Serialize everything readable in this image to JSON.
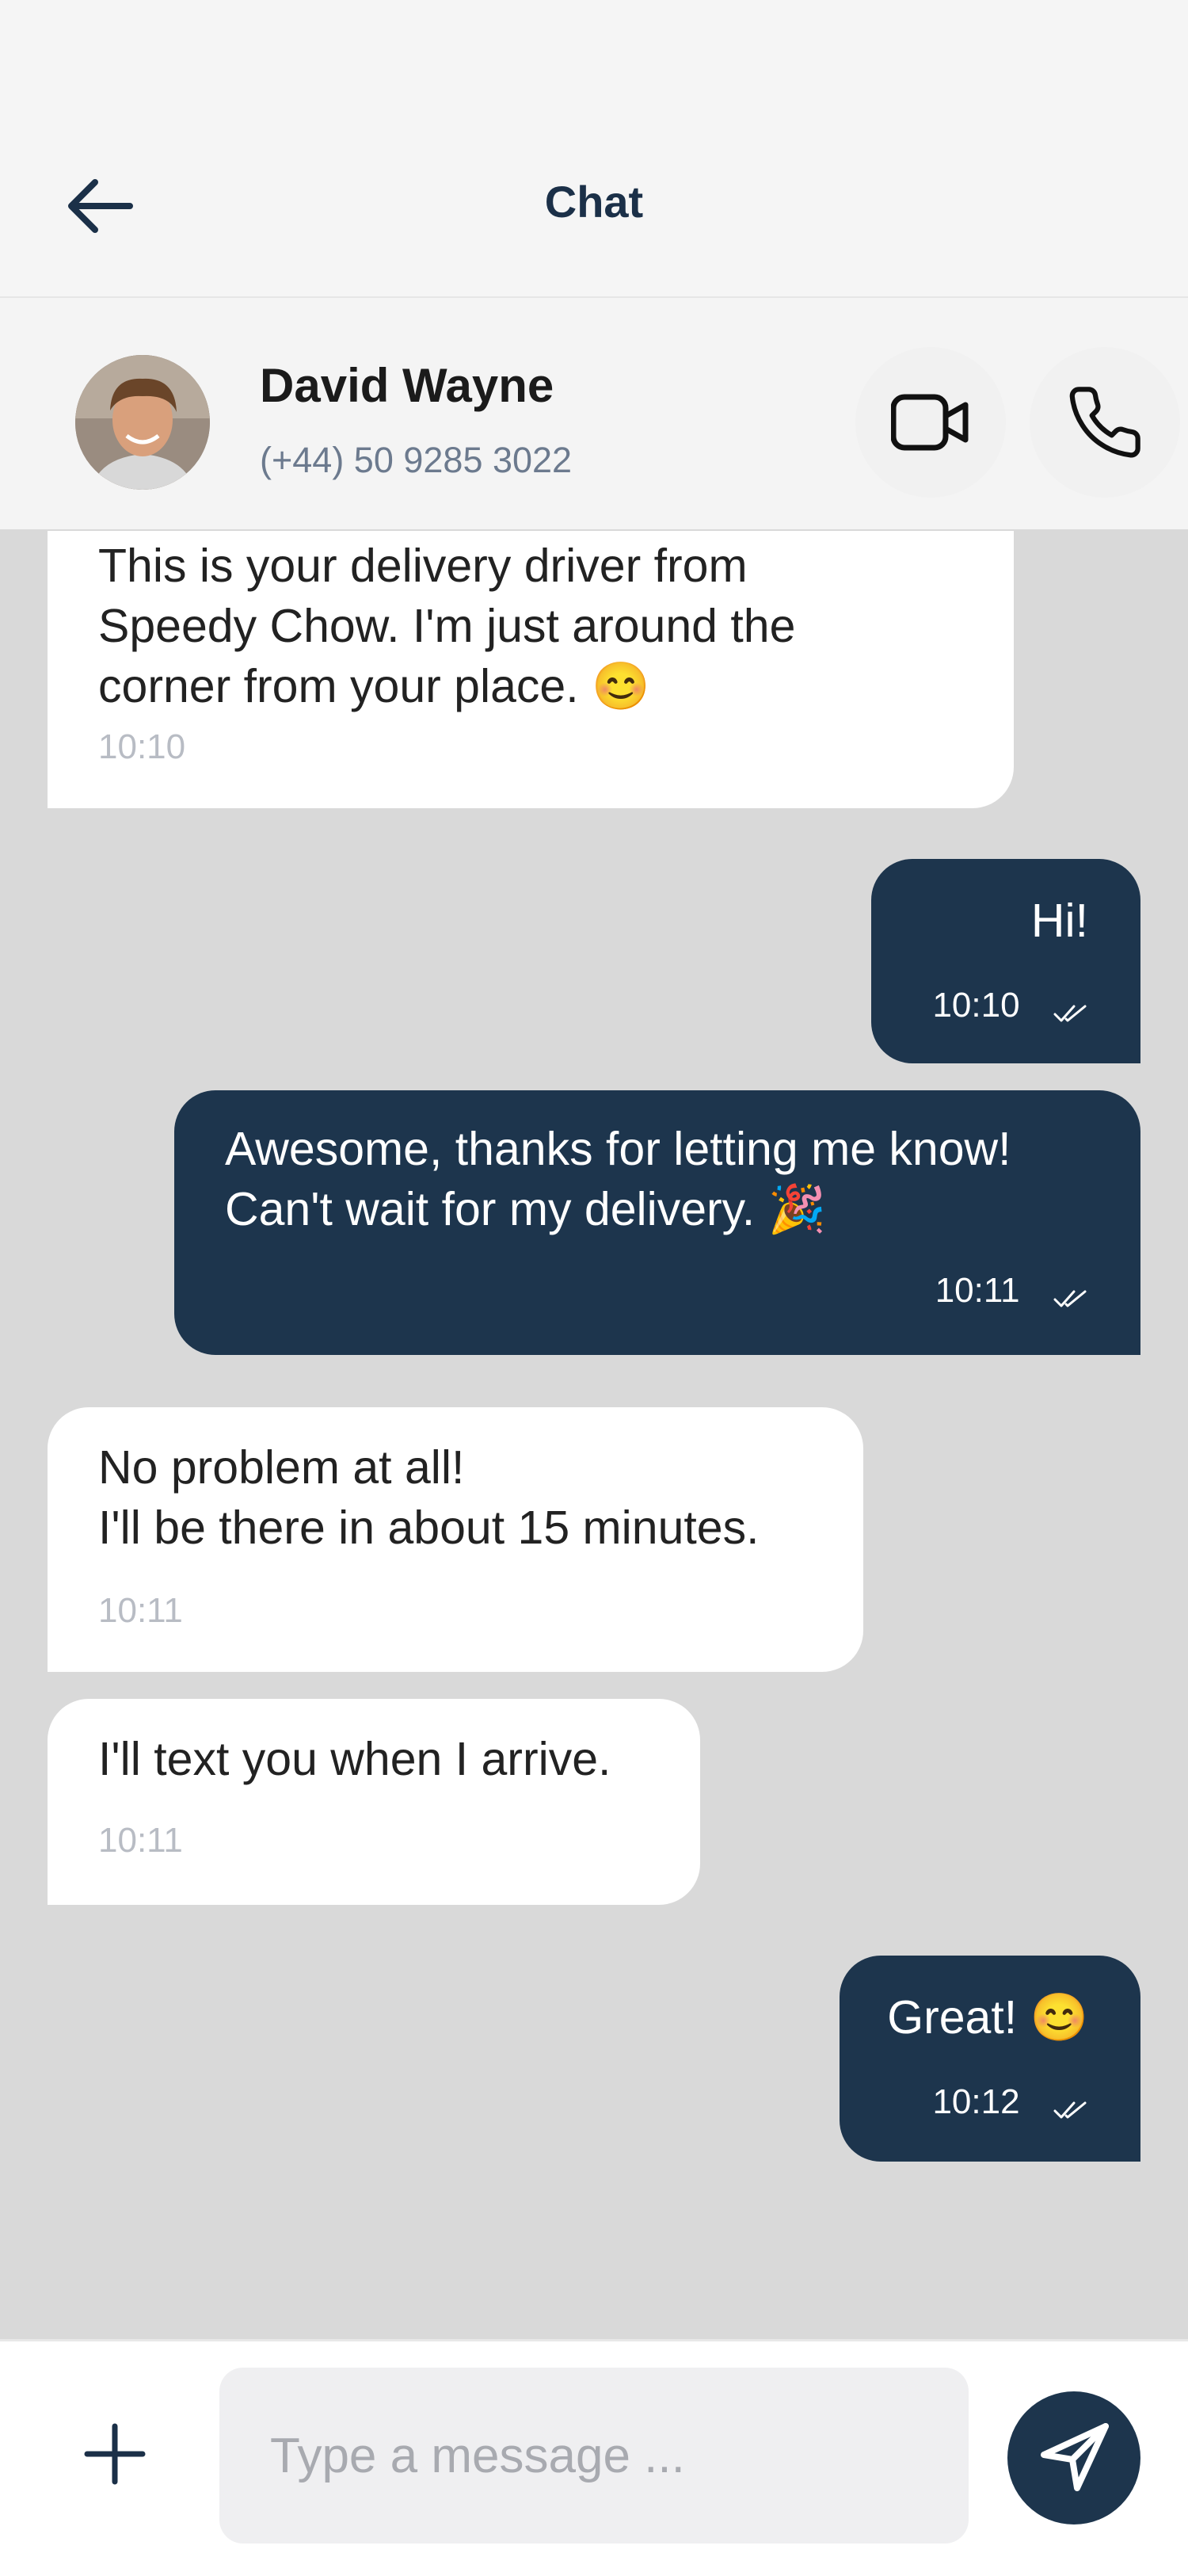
{
  "header": {
    "title": "Chat",
    "back_icon": "arrow-left-icon"
  },
  "contact": {
    "name": "David Wayne",
    "phone": "(+44) 50 9285 3022",
    "video_icon": "video-camera-icon",
    "call_icon": "phone-icon"
  },
  "messages": [
    {
      "direction": "incoming",
      "text": "This is your delivery driver from\nSpeedy Chow. I'm just around the\ncorner from your place. 😊",
      "time": "10:10"
    },
    {
      "direction": "outgoing",
      "text": "Hi!",
      "time": "10:10",
      "read": true
    },
    {
      "direction": "outgoing",
      "text": "Awesome, thanks for letting me know!\nCan't wait for my delivery. 🎉",
      "time": "10:11",
      "read": true
    },
    {
      "direction": "incoming",
      "text": "No problem at all!\nI'll be there in about 15 minutes.",
      "time": "10:11"
    },
    {
      "direction": "incoming",
      "text": "I'll text you when I arrive.",
      "time": "10:11"
    },
    {
      "direction": "outgoing",
      "text": "Great! 😊",
      "time": "10:12",
      "read": true
    }
  ],
  "composer": {
    "placeholder": "Type a message ...",
    "value": ""
  },
  "colors": {
    "brand": "#1d354d",
    "chat_background": "#d9d9d9",
    "incoming_bubble": "#ffffff"
  }
}
